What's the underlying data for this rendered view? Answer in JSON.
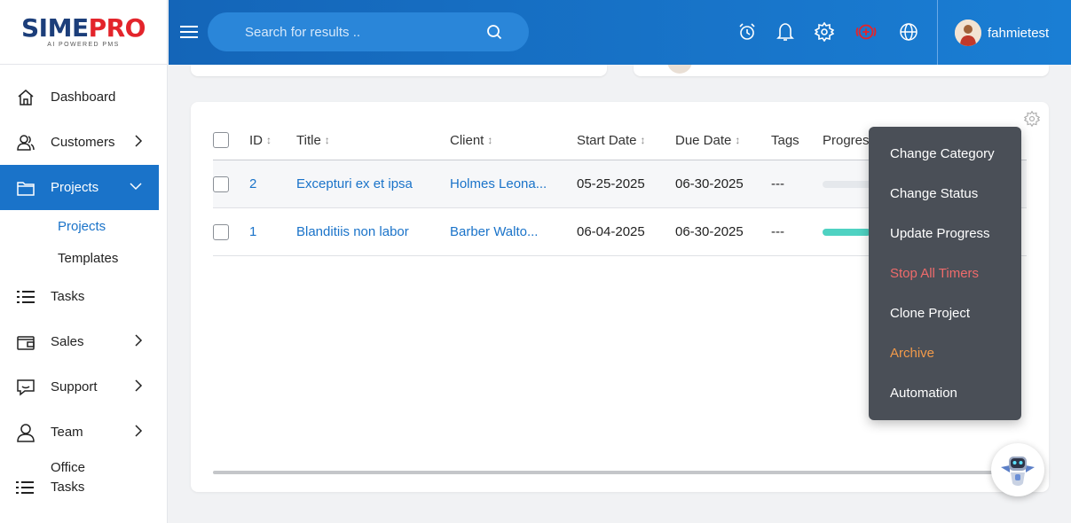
{
  "brand": {
    "name_part1": "SIME",
    "name_part2": "PRO",
    "tagline": "AI POWERED PMS"
  },
  "header": {
    "search_placeholder": "Search for results ..",
    "username": "fahmietest"
  },
  "sidebar": {
    "items": [
      {
        "label": "Dashboard"
      },
      {
        "label": "Customers"
      },
      {
        "label": "Projects"
      },
      {
        "label": "Tasks"
      },
      {
        "label": "Sales"
      },
      {
        "label": "Support"
      },
      {
        "label": "Team"
      },
      {
        "label": "Office Tasks"
      }
    ],
    "projects_sub": [
      {
        "label": "Projects"
      },
      {
        "label": "Templates"
      }
    ]
  },
  "table": {
    "columns": [
      "ID",
      "Title",
      "Client",
      "Start Date",
      "Due Date",
      "Tags",
      "Progress"
    ],
    "rows": [
      {
        "id": "2",
        "title": "Excepturi ex et ipsa",
        "client": "Holmes Leona...",
        "start": "05-25-2025",
        "due": "06-30-2025",
        "tags": "---",
        "progress": 0
      },
      {
        "id": "1",
        "title": "Blanditiis non labor",
        "client": "Barber Walto...",
        "start": "06-04-2025",
        "due": "06-30-2025",
        "tags": "---",
        "progress": 0.9
      }
    ]
  },
  "dropdown": {
    "items": [
      {
        "label": "Change Category"
      },
      {
        "label": "Change Status"
      },
      {
        "label": "Update Progress"
      },
      {
        "label": "Stop All Timers"
      },
      {
        "label": "Clone Project"
      },
      {
        "label": "Archive"
      },
      {
        "label": "Automation"
      }
    ]
  },
  "colors": {
    "primary": "#1a73c9",
    "danger": "#ef6b6b",
    "warn": "#f29a4a",
    "progress": "#4fd2c2"
  }
}
